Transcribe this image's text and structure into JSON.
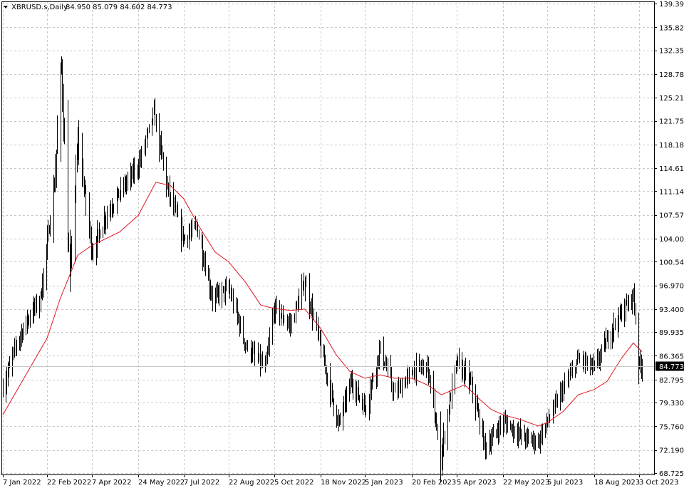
{
  "header": {
    "symbol_label": "XBRUSD.s,Daily",
    "ohlc_text": "84.950 85.079 84.602 84.773",
    "dropdown_icon": "triangle-down-icon"
  },
  "colors": {
    "background": "#ffffff",
    "bars": "#000000",
    "moving_average": "#e0141e",
    "grid": "#c8c8c8",
    "last_price_tag": "#000000"
  },
  "chart_data": {
    "type": "line",
    "symbol": "XBRUSD.s",
    "timeframe": "Daily",
    "price_bars": "ohlc",
    "ylim": [
      68.725,
      139.39
    ],
    "grid": true,
    "y_ticks": [
      "139.390",
      "135.820",
      "132.355",
      "128.785",
      "125.215",
      "121.750",
      "118.180",
      "114.610",
      "111.145",
      "107.575",
      "104.005",
      "100.540",
      "96.970",
      "93.400",
      "89.935",
      "86.365",
      "82.795",
      "79.330",
      "75.760",
      "72.190",
      "68.725"
    ],
    "x_ticks": [
      "7 Jan 2022",
      "22 Feb 2022",
      "7 Apr 2022",
      "24 May 2022",
      "7 Jul 2022",
      "22 Aug 2022",
      "5 Oct 2022",
      "18 Nov 2022",
      "5 Jan 2023",
      "20 Feb 2023",
      "5 Apr 2023",
      "22 May 2023",
      "5 Jul 2023",
      "18 Aug 2023",
      "3 Oct 2023"
    ],
    "last_price": 84.773,
    "last_price_label": "84.773",
    "price_path": [
      {
        "date": "7 Jan 2022",
        "close": 81.5
      },
      {
        "date": "21 Jan 2022",
        "close": 88.2
      },
      {
        "date": "4 Feb 2022",
        "close": 92.5
      },
      {
        "date": "15 Feb 2022",
        "close": 95.0
      },
      {
        "date": "1 Mar 2022",
        "close": 112.0
      },
      {
        "date": "8 Mar 2022",
        "close": 130.0
      },
      {
        "date": "16 Mar 2022",
        "close": 98.0
      },
      {
        "date": "24 Mar 2022",
        "close": 119.0
      },
      {
        "date": "7 Apr 2022",
        "close": 102.0
      },
      {
        "date": "21 Apr 2022",
        "close": 107.5
      },
      {
        "date": "5 May 2022",
        "close": 111.0
      },
      {
        "date": "24 May 2022",
        "close": 115.0
      },
      {
        "date": "8 Jun 2022",
        "close": 123.0
      },
      {
        "date": "22 Jun 2022",
        "close": 111.0
      },
      {
        "date": "7 Jul 2022",
        "close": 104.0
      },
      {
        "date": "20 Jul 2022",
        "close": 106.0
      },
      {
        "date": "5 Aug 2022",
        "close": 95.0
      },
      {
        "date": "22 Aug 2022",
        "close": 96.5
      },
      {
        "date": "7 Sep 2022",
        "close": 88.0
      },
      {
        "date": "26 Sep 2022",
        "close": 84.5
      },
      {
        "date": "5 Oct 2022",
        "close": 93.5
      },
      {
        "date": "20 Oct 2022",
        "close": 91.0
      },
      {
        "date": "3 Nov 2022",
        "close": 97.5
      },
      {
        "date": "18 Nov 2022",
        "close": 87.5
      },
      {
        "date": "7 Dec 2022",
        "close": 76.0
      },
      {
        "date": "21 Dec 2022",
        "close": 82.5
      },
      {
        "date": "5 Jan 2023",
        "close": 78.5
      },
      {
        "date": "20 Jan 2023",
        "close": 87.5
      },
      {
        "date": "3 Feb 2023",
        "close": 80.5
      },
      {
        "date": "20 Feb 2023",
        "close": 84.0
      },
      {
        "date": "7 Mar 2023",
        "close": 85.0
      },
      {
        "date": "20 Mar 2023",
        "close": 71.0
      },
      {
        "date": "29 Mar 2023",
        "close": 79.5
      },
      {
        "date": "5 Apr 2023",
        "close": 85.5
      },
      {
        "date": "20 Apr 2023",
        "close": 82.0
      },
      {
        "date": "4 May 2023",
        "close": 72.5
      },
      {
        "date": "22 May 2023",
        "close": 76.5
      },
      {
        "date": "12 Jun 2023",
        "close": 74.0
      },
      {
        "date": "26 Jun 2023",
        "close": 73.5
      },
      {
        "date": "5 Jul 2023",
        "close": 76.5
      },
      {
        "date": "20 Jul 2023",
        "close": 81.5
      },
      {
        "date": "3 Aug 2023",
        "close": 86.0
      },
      {
        "date": "18 Aug 2023",
        "close": 84.5
      },
      {
        "date": "5 Sep 2023",
        "close": 90.5
      },
      {
        "date": "18 Sep 2023",
        "close": 93.5
      },
      {
        "date": "27 Sep 2023",
        "close": 95.5
      },
      {
        "date": "3 Oct 2023",
        "close": 85.0
      },
      {
        "date": "6 Oct 2023",
        "close": 84.773
      }
    ],
    "moving_average_path": [
      {
        "date": "7 Jan 2022",
        "value": 77.5
      },
      {
        "date": "4 Feb 2022",
        "value": 84.5
      },
      {
        "date": "22 Feb 2022",
        "value": 89.0
      },
      {
        "date": "7 Mar 2022",
        "value": 95.0
      },
      {
        "date": "24 Mar 2022",
        "value": 101.5
      },
      {
        "date": "7 Apr 2022",
        "value": 103.0
      },
      {
        "date": "5 May 2022",
        "value": 105.0
      },
      {
        "date": "24 May 2022",
        "value": 107.5
      },
      {
        "date": "10 Jun 2022",
        "value": 112.5
      },
      {
        "date": "24 Jun 2022",
        "value": 112.0
      },
      {
        "date": "7 Jul 2022",
        "value": 110.0
      },
      {
        "date": "22 Jul 2022",
        "value": 106.0
      },
      {
        "date": "8 Aug 2022",
        "value": 102.0
      },
      {
        "date": "22 Aug 2022",
        "value": 100.5
      },
      {
        "date": "7 Sep 2022",
        "value": 97.5
      },
      {
        "date": "22 Sep 2022",
        "value": 94.0
      },
      {
        "date": "5 Oct 2022",
        "value": 93.5
      },
      {
        "date": "20 Oct 2022",
        "value": 93.2
      },
      {
        "date": "3 Nov 2022",
        "value": 93.4
      },
      {
        "date": "18 Nov 2022",
        "value": 90.5
      },
      {
        "date": "5 Dec 2022",
        "value": 86.5
      },
      {
        "date": "20 Dec 2022",
        "value": 84.0
      },
      {
        "date": "5 Jan 2023",
        "value": 83.0
      },
      {
        "date": "20 Jan 2023",
        "value": 83.5
      },
      {
        "date": "3 Feb 2023",
        "value": 83.0
      },
      {
        "date": "20 Feb 2023",
        "value": 83.0
      },
      {
        "date": "7 Mar 2023",
        "value": 82.0
      },
      {
        "date": "21 Mar 2023",
        "value": 80.5
      },
      {
        "date": "5 Apr 2023",
        "value": 81.5
      },
      {
        "date": "13 Apr 2023",
        "value": 82.0
      },
      {
        "date": "27 Apr 2023",
        "value": 80.0
      },
      {
        "date": "10 May 2023",
        "value": 78.3
      },
      {
        "date": "22 May 2023",
        "value": 77.5
      },
      {
        "date": "8 Jun 2023",
        "value": 76.8
      },
      {
        "date": "26 Jun 2023",
        "value": 75.8
      },
      {
        "date": "5 Jul 2023",
        "value": 76.3
      },
      {
        "date": "20 Jul 2023",
        "value": 78.0
      },
      {
        "date": "3 Aug 2023",
        "value": 80.5
      },
      {
        "date": "18 Aug 2023",
        "value": 81.3
      },
      {
        "date": "31 Aug 2023",
        "value": 82.5
      },
      {
        "date": "15 Sep 2023",
        "value": 86.0
      },
      {
        "date": "27 Sep 2023",
        "value": 88.3
      },
      {
        "date": "6 Oct 2023",
        "value": 87.0
      }
    ]
  }
}
